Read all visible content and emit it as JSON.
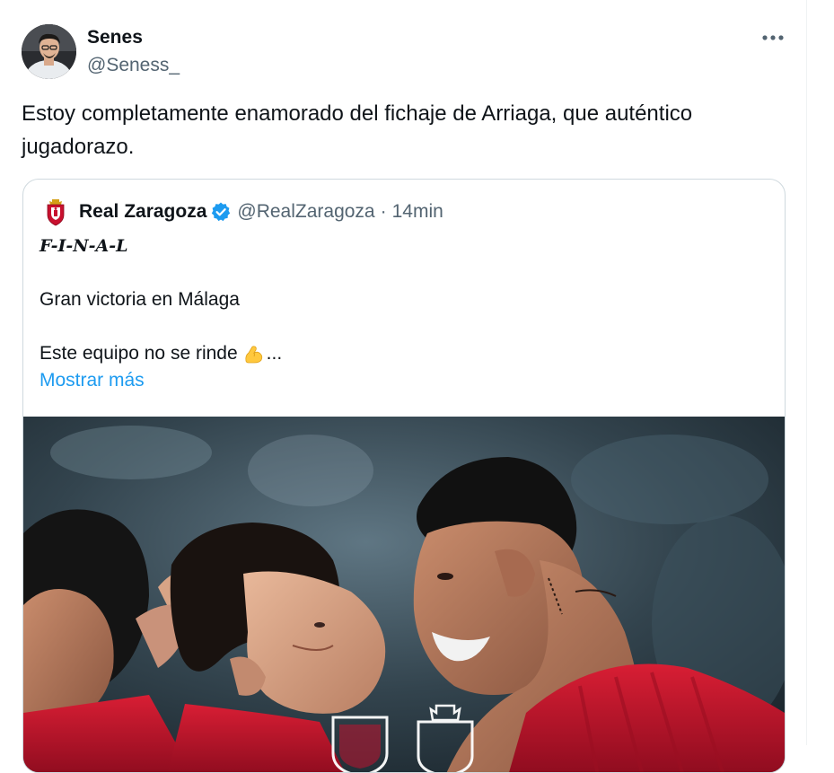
{
  "tweet": {
    "author_name": "Senes",
    "author_handle": "@Seness_",
    "text": "Estoy completamente enamorado del fichaje de Arriaga, que auténtico jugadorazo.",
    "more_icon": "more-horizontal-icon"
  },
  "quoted": {
    "author_name": "Real Zaragoza",
    "author_handle": "@RealZaragoza",
    "separator": "·",
    "time": "14min",
    "line1": "F-I-N-A-L",
    "line2": "Gran victoria en Málaga",
    "line3": "Este equipo no se rinde",
    "line3_suffix": "...",
    "show_more": "Mostrar más",
    "verified_icon": "verified-badge-icon",
    "media_icon": "match-photo",
    "colors": {
      "link": "#1d9bf0",
      "verified": "#1d9bf0",
      "kit_red": "#c8102e"
    }
  }
}
